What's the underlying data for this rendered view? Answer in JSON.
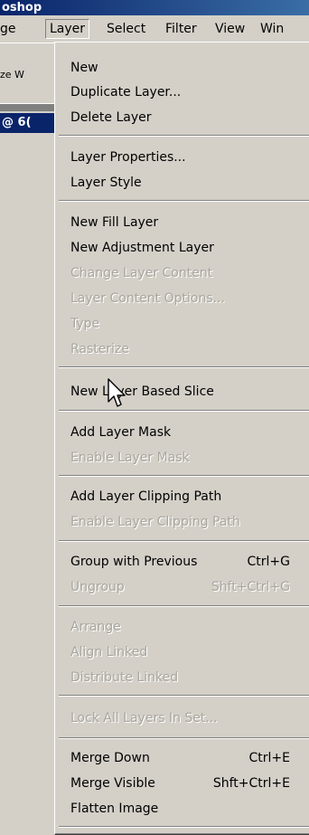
{
  "window": {
    "title_fragment": "oshop"
  },
  "menubar": {
    "items": [
      {
        "label": "ge",
        "active": false
      },
      {
        "label": "Layer",
        "active": true
      },
      {
        "label": "Select",
        "active": false
      },
      {
        "label": "Filter",
        "active": false
      },
      {
        "label": "View",
        "active": false
      },
      {
        "label": "Win",
        "active": false
      }
    ]
  },
  "options_bar": {
    "text_fragment": "ze W"
  },
  "document": {
    "title_fragment": "@ 6("
  },
  "layer_menu": {
    "items": {
      "new": "New",
      "duplicate_layer": "Duplicate Layer...",
      "delete_layer": "Delete Layer",
      "layer_properties": "Layer Properties...",
      "layer_style": "Layer Style",
      "new_fill_layer": "New Fill Layer",
      "new_adjustment_layer": "New Adjustment Layer",
      "change_layer_content": "Change Layer Content",
      "layer_content_options": "Layer Content Options...",
      "type": "Type",
      "rasterize": "Rasterize",
      "new_layer_based_slice": "New Layer Based Slice",
      "add_layer_mask": "Add Layer Mask",
      "enable_layer_mask": "Enable Layer Mask",
      "add_layer_clipping_path": "Add Layer Clipping Path",
      "enable_layer_clipping_path": "Enable Layer Clipping Path",
      "group_with_previous": "Group with Previous",
      "ungroup": "Ungroup",
      "arrange": "Arrange",
      "align_linked": "Align Linked",
      "distribute_linked": "Distribute Linked",
      "lock_all_layers_in_set": "Lock All Layers In Set...",
      "merge_down": "Merge Down",
      "merge_visible": "Merge Visible",
      "flatten_image": "Flatten Image"
    },
    "shortcuts": {
      "group_with_previous": "Ctrl+G",
      "ungroup": "Shft+Ctrl+G",
      "merge_down": "Ctrl+E",
      "merge_visible": "Shft+Ctrl+E"
    }
  },
  "colors": {
    "title_bar": "#0a246a",
    "menu_bg": "#d4d0c8",
    "disabled_text": "#a9a69d"
  }
}
